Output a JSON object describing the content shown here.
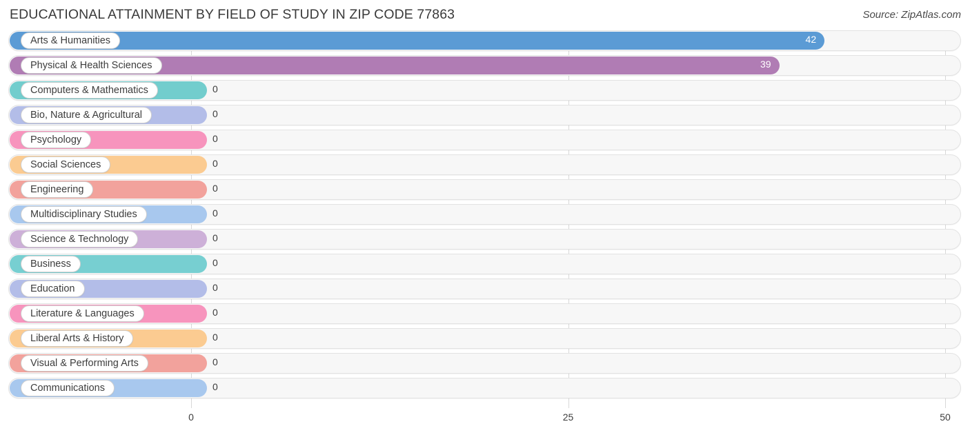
{
  "header": {
    "title": "EDUCATIONAL ATTAINMENT BY FIELD OF STUDY IN ZIP CODE 77863",
    "source": "Source: ZipAtlas.com"
  },
  "chart_data": {
    "type": "bar",
    "orientation": "horizontal",
    "title": "EDUCATIONAL ATTAINMENT BY FIELD OF STUDY IN ZIP CODE 77863",
    "xlabel": "",
    "ylabel": "",
    "xlim": [
      0,
      50
    ],
    "xticks": [
      "0",
      "25",
      "50"
    ],
    "xtick_values": [
      0,
      25,
      50
    ],
    "grid": true,
    "legend": false,
    "categories": [
      "Arts & Humanities",
      "Physical & Health Sciences",
      "Computers & Mathematics",
      "Bio, Nature & Agricultural",
      "Psychology",
      "Social Sciences",
      "Engineering",
      "Multidisciplinary Studies",
      "Science & Technology",
      "Business",
      "Education",
      "Literature & Languages",
      "Liberal Arts & History",
      "Visual & Performing Arts",
      "Communications"
    ],
    "values": [
      42,
      39,
      0,
      0,
      0,
      0,
      0,
      0,
      0,
      0,
      0,
      0,
      0,
      0,
      0
    ],
    "value_labels": [
      "42",
      "39",
      "0",
      "0",
      "0",
      "0",
      "0",
      "0",
      "0",
      "0",
      "0",
      "0",
      "0",
      "0",
      "0"
    ],
    "colors": [
      "#5b9bd5",
      "#b07cb4",
      "#72cdcd",
      "#b3bde8",
      "#f794bd",
      "#fbcb91",
      "#f2a29c",
      "#a8c8ee",
      "#cdb0d8",
      "#77cfd1",
      "#b3bde8",
      "#f794bd",
      "#fbcb91",
      "#f2a29c",
      "#a8c8ee"
    ]
  }
}
